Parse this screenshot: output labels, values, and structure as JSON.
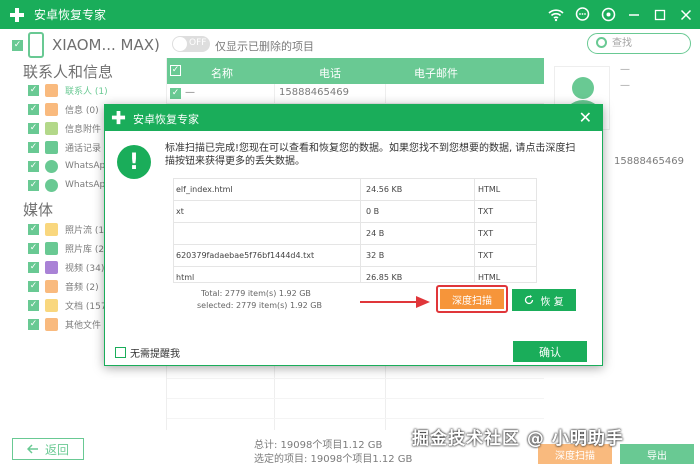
{
  "app": {
    "title": "安卓恢复专家"
  },
  "device": {
    "name": "XIAOM... MAX)",
    "toggle_label": "OFF",
    "only_deleted_label": "仅显示已删除的项目"
  },
  "search": {
    "placeholder": "查找"
  },
  "sidebar": {
    "section_contacts": "联系人和信息",
    "section_media": "媒体",
    "items": [
      {
        "label": "联系人 (1)",
        "icon": "contacts-icon",
        "color": "#f6953a"
      },
      {
        "label": "信息 (0)",
        "icon": "message-icon",
        "color": "#f6953a"
      },
      {
        "label": "信息附件",
        "icon": "attachment-icon",
        "color": "#8bc34a"
      },
      {
        "label": "通话记录",
        "icon": "call-log-icon",
        "color": "#1aad5a"
      },
      {
        "label": "WhatsAp",
        "icon": "whatsapp-icon",
        "color": "#1aad5a"
      },
      {
        "label": "WhatsAp",
        "icon": "whatsapp-attachment-icon",
        "color": "#1aad5a"
      },
      {
        "label": "照片流 (1)",
        "icon": "photo-stream-icon",
        "color": "#f6c23a"
      },
      {
        "label": "照片库 (2",
        "icon": "photo-library-icon",
        "color": "#1aad5a"
      },
      {
        "label": "视频 (34)",
        "icon": "video-icon",
        "color": "#7b3fc0"
      },
      {
        "label": "音频 (2)",
        "icon": "audio-icon",
        "color": "#f6953a"
      },
      {
        "label": "文档 (157",
        "icon": "document-icon",
        "color": "#f6c23a"
      },
      {
        "label": "其他文件",
        "icon": "other-files-icon",
        "color": "#f6953a"
      }
    ]
  },
  "table": {
    "headers": {
      "name": "名称",
      "phone": "电话",
      "email": "电子邮件"
    },
    "row1": {
      "name": "—",
      "phone": "15888465469"
    }
  },
  "detail": {
    "phone": "15888465469"
  },
  "footer": {
    "back": "返回",
    "total": "总计: 19098个项目1.12 GB",
    "selected": "选定的项目: 19098个项目1.12 GB",
    "deep_scan": "深度扫描",
    "export": "导出"
  },
  "watermark": "掘金技术社区 @ 小明助手",
  "dialog": {
    "title": "安卓恢复专家",
    "message": "标准扫描已完成!您现在可以查看和恢复您的数据。如果您找不到您想要的数据, 请点击深度扫描按钮来获得更多的丢失数据。",
    "files": [
      {
        "name": "elf_index.html",
        "size": "24.56 KB",
        "type": "HTML"
      },
      {
        "name": "xt",
        "size": "0 B",
        "type": "TXT"
      },
      {
        "name": "",
        "size": "24 B",
        "type": "TXT"
      },
      {
        "name": "620379fadaebae5f76bf1444d4.txt",
        "size": "32 B",
        "type": "TXT"
      },
      {
        "name": "html",
        "size": "26.85 KB",
        "type": "HTML"
      }
    ],
    "total": "Total: 2779 item(s) 1.92 GB",
    "selected": "selected: 2779 item(s) 1.92 GB",
    "deep_scan": "深度扫描",
    "recover": "恢 复",
    "no_remind": "无需提醒我",
    "confirm": "确认"
  }
}
